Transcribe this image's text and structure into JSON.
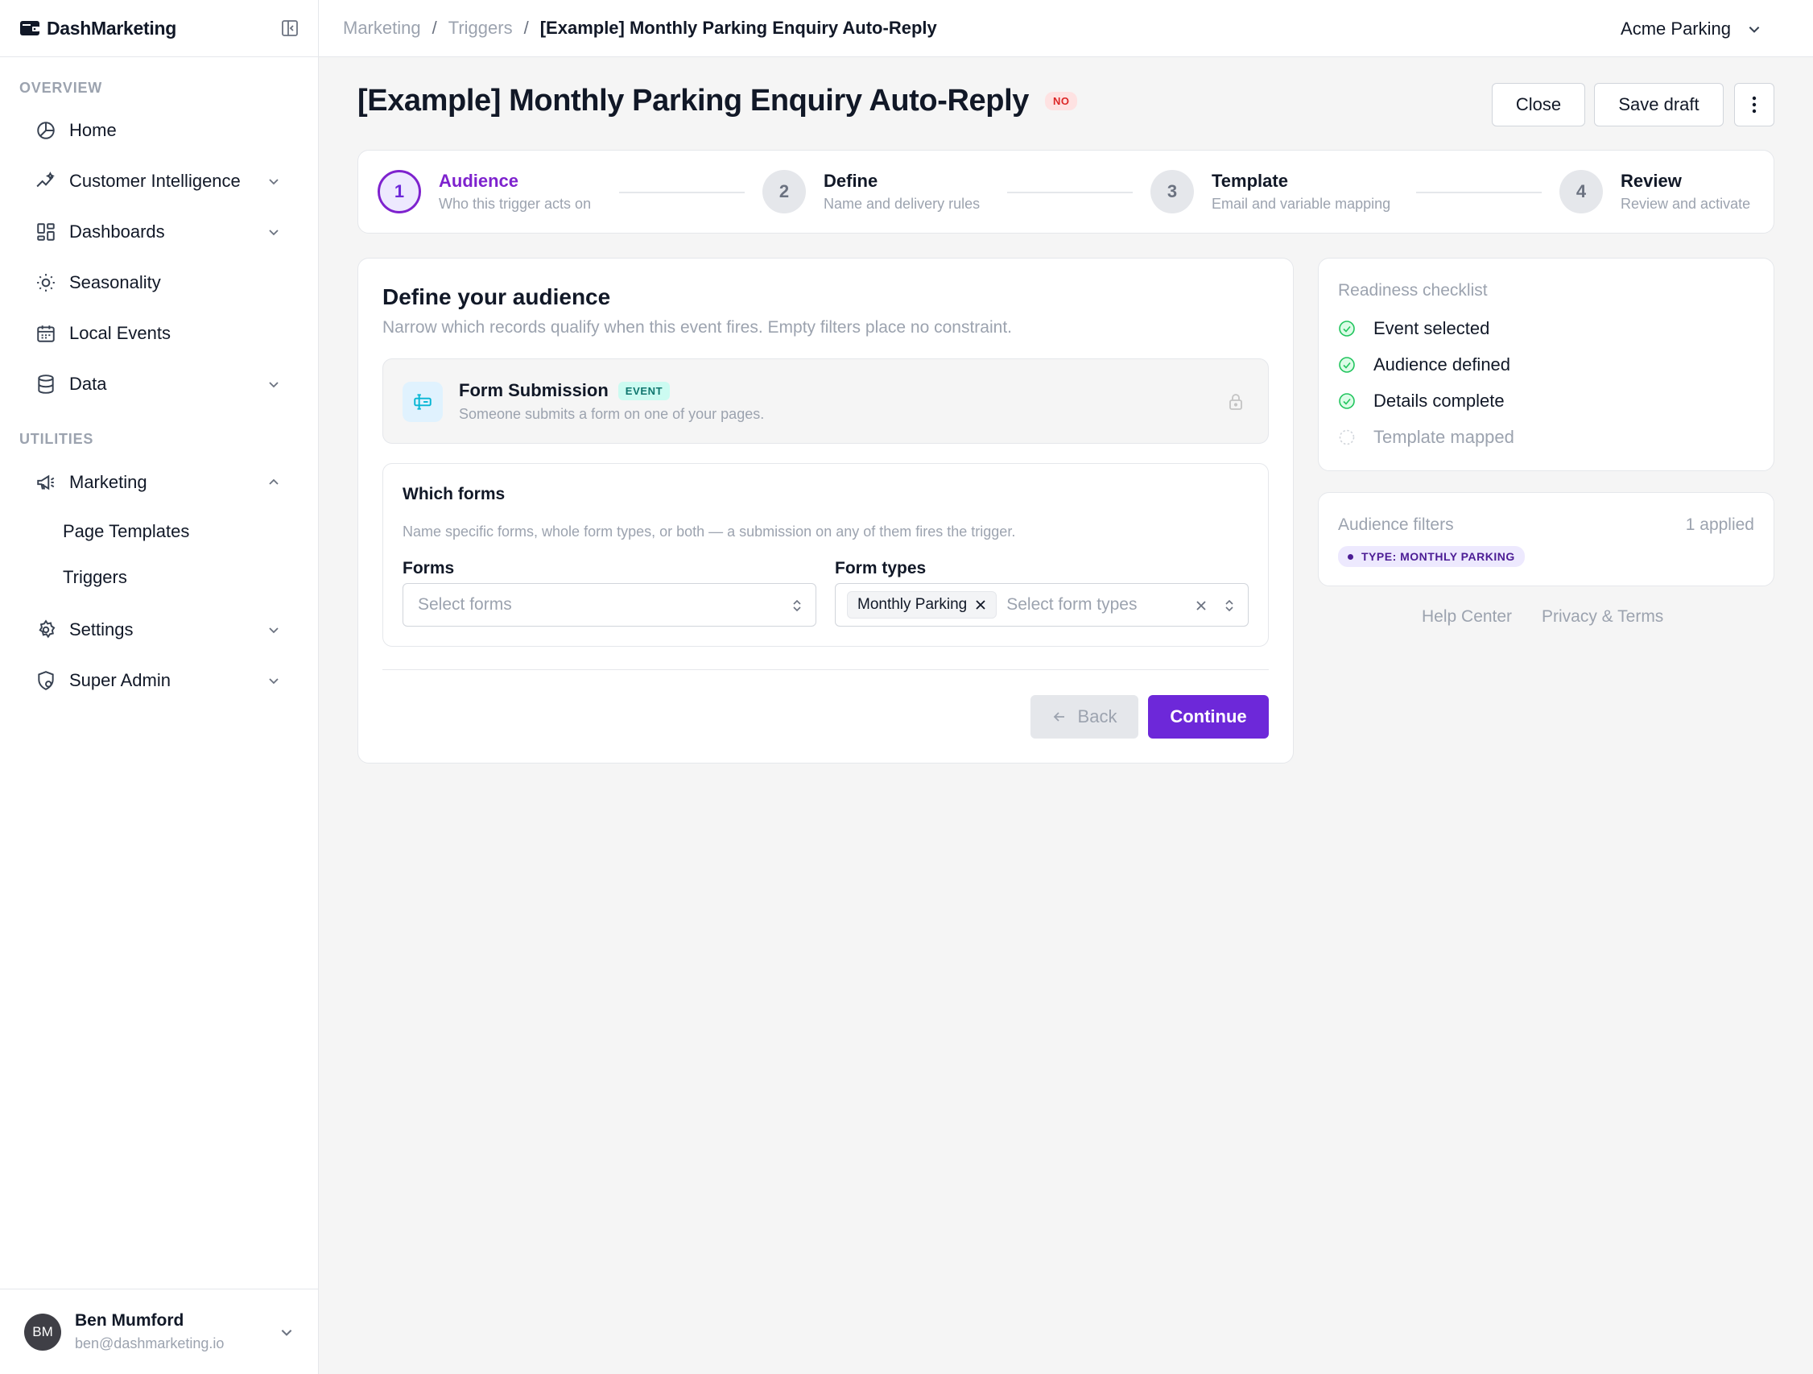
{
  "app": {
    "name": "DashMarketing"
  },
  "sidebar": {
    "sections": {
      "overview": "OVERVIEW",
      "utilities": "UTILITIES"
    },
    "items": [
      {
        "label": "Home",
        "icon": "pie-chart-icon"
      },
      {
        "label": "Customer Intelligence",
        "icon": "sparkline-icon"
      },
      {
        "label": "Dashboards",
        "icon": "dashboard-grid-icon"
      },
      {
        "label": "Seasonality",
        "icon": "sun-icon"
      },
      {
        "label": "Local Events",
        "icon": "calendar-icon"
      },
      {
        "label": "Data",
        "icon": "database-icon"
      },
      {
        "label": "Marketing",
        "icon": "megaphone-icon"
      },
      {
        "label": "Settings",
        "icon": "gear-icon"
      },
      {
        "label": "Super Admin",
        "icon": "shield-icon"
      }
    ],
    "marketing_sub": [
      "Page Templates",
      "Triggers"
    ],
    "user": {
      "initials": "BM",
      "name": "Ben Mumford",
      "email": "ben@dashmarketing.io"
    }
  },
  "topbar": {
    "breadcrumb": [
      "Marketing",
      "Triggers",
      "[Example] Monthly Parking Enquiry Auto-Reply"
    ],
    "separator": "/",
    "org": "Acme Parking"
  },
  "header": {
    "title": "[Example] Monthly Parking Enquiry Auto-Reply",
    "status": "NO",
    "close_label": "Close",
    "save_label": "Save draft"
  },
  "stepper": [
    {
      "number": "1",
      "title": "Audience",
      "subtitle": "Who this trigger acts on",
      "active": true
    },
    {
      "number": "2",
      "title": "Define",
      "subtitle": "Name and delivery rules",
      "active": false
    },
    {
      "number": "3",
      "title": "Template",
      "subtitle": "Email and variable mapping",
      "active": false
    },
    {
      "number": "4",
      "title": "Review",
      "subtitle": "Review and activate",
      "active": false
    }
  ],
  "audience": {
    "heading": "Define your audience",
    "subheading": "Narrow which records qualify when this event fires. Empty filters place no constraint.",
    "event": {
      "title": "Form Submission",
      "tag": "EVENT",
      "description": "Someone submits a form on one of your pages."
    },
    "forms_section": {
      "heading": "Which forms",
      "help": "Name specific forms, whole form types, or both — a submission on any of them fires the trigger.",
      "forms_label": "Forms",
      "forms_placeholder": "Select forms",
      "types_label": "Form types",
      "types_chip": "Monthly Parking",
      "types_placeholder": "Select form types"
    },
    "back_label": "Back",
    "continue_label": "Continue"
  },
  "checklist": {
    "heading": "Readiness checklist",
    "items": [
      {
        "label": "Event selected",
        "done": true
      },
      {
        "label": "Audience defined",
        "done": true
      },
      {
        "label": "Details complete",
        "done": true
      },
      {
        "label": "Template mapped",
        "done": false
      }
    ]
  },
  "filters": {
    "heading": "Audience filters",
    "count": "1 applied",
    "pill": "TYPE: MONTHLY PARKING"
  },
  "footer": {
    "help": "Help Center",
    "privacy": "Privacy & Terms"
  },
  "colors": {
    "accent": "#6d28d9",
    "success": "#22c55e",
    "danger": "#dc2626",
    "teal": "#0f766e"
  }
}
